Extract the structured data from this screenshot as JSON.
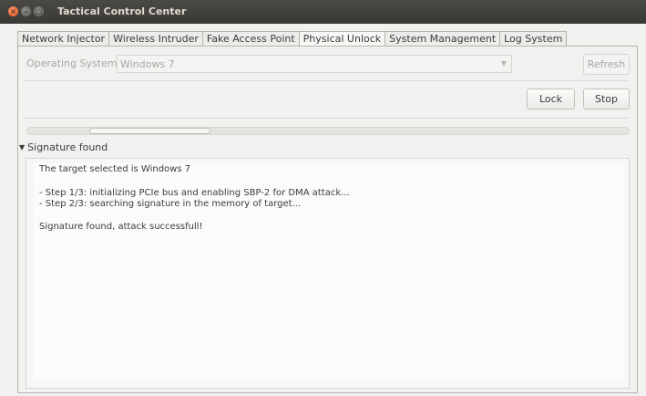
{
  "window": {
    "title": "Tactical Control Center",
    "controls": {
      "close": "×",
      "minimize": "–",
      "maximize": "□"
    }
  },
  "tabs": [
    {
      "label": "Network Injector",
      "active": false
    },
    {
      "label": "Wireless Intruder",
      "active": false
    },
    {
      "label": "Fake Access Point",
      "active": false
    },
    {
      "label": "Physical Unlock",
      "active": true
    },
    {
      "label": "System Management",
      "active": false
    },
    {
      "label": "Log System",
      "active": false
    }
  ],
  "panel": {
    "os_label": "Operating System:",
    "os_value": "Windows 7",
    "dropdown_arrow": "▼",
    "refresh_label": "Refresh",
    "lock_label": "Lock",
    "stop_label": "Stop",
    "progress_fraction": 0.2
  },
  "expander": {
    "arrow": "▼",
    "label": "Signature found"
  },
  "log": {
    "lines": [
      "The target selected is Windows 7",
      "",
      "- Step 1/3: initializing PCIe bus and enabling SBP-2 for DMA attack...",
      "- Step 2/3: searching signature in the memory of target...",
      "",
      "Signature found, attack successfull!"
    ]
  },
  "colors": {
    "titlebar": "#3c3b37",
    "title_text": "#dfdbd2",
    "close_button": "#e9592a",
    "background": "#f2f1f0"
  }
}
